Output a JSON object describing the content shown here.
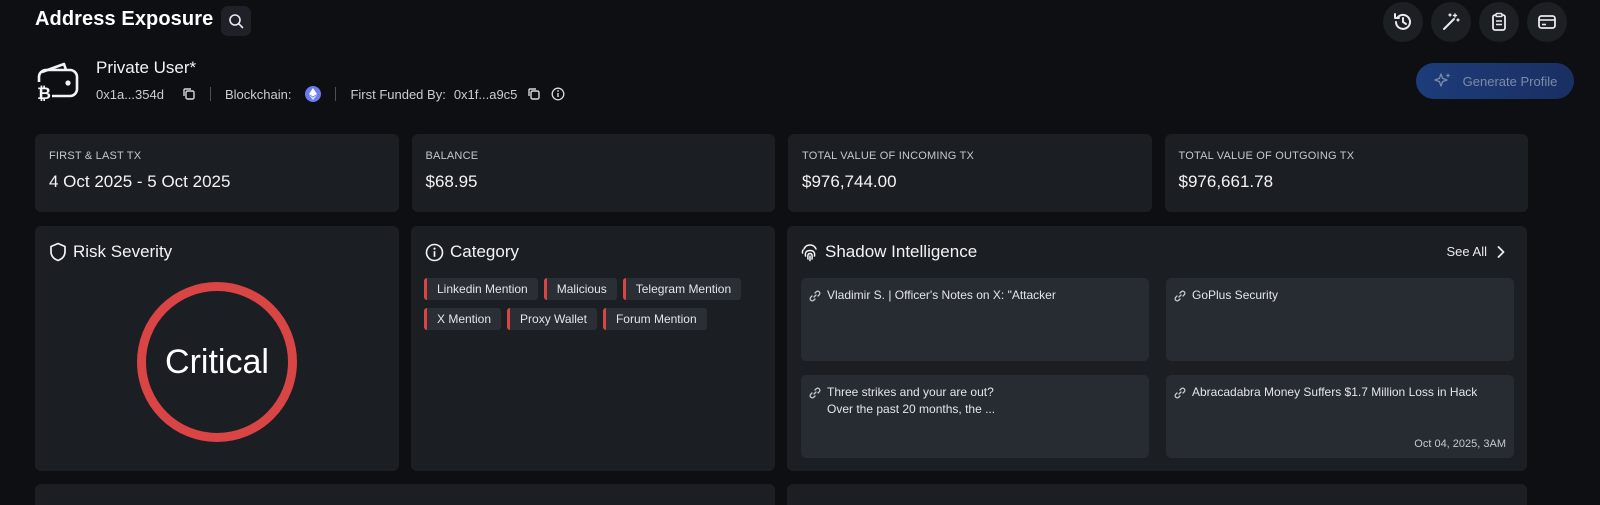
{
  "header": {
    "title": "Address Exposure",
    "icons": [
      "search-icon",
      "history-icon",
      "magic-wand-icon",
      "clipboard-icon",
      "card-icon"
    ]
  },
  "profile": {
    "name": "Private User*",
    "address": "0x1a...354d",
    "blockchain_label": "Blockchain:",
    "first_funded_label": "First Funded By:",
    "first_funded_address": "0x1f...a9c5",
    "generate_button": "Generate Profile"
  },
  "stats": [
    {
      "label": "FIRST & LAST TX",
      "value": "4 Oct 2025 - 5 Oct 2025"
    },
    {
      "label": "BALANCE",
      "value": "$68.95"
    },
    {
      "label": "TOTAL VALUE OF INCOMING TX",
      "value": "$976,744.00"
    },
    {
      "label": "TOTAL VALUE OF OUTGOING TX",
      "value": "$976,661.78"
    }
  ],
  "risk": {
    "title": "Risk Severity",
    "level": "Critical",
    "color": "#d94444"
  },
  "category": {
    "title": "Category",
    "tags": [
      "Linkedin Mention",
      "Malicious",
      "Telegram Mention",
      "X Mention",
      "Proxy Wallet",
      "Forum Mention"
    ]
  },
  "shadow": {
    "title": "Shadow Intelligence",
    "see_all": "See All",
    "cards": [
      {
        "line1": "Vladimir S. | Officer's Notes on X: \"Attacker",
        "line2": "",
        "date": ""
      },
      {
        "line1": "GoPlus Security",
        "line2": "",
        "date": ""
      },
      {
        "line1": "Three strikes and your are out?",
        "line2": "Over the past 20 months, the ...",
        "date": ""
      },
      {
        "line1": "Abracadabra Money Suffers $1.7 Million Loss in Hack",
        "line2": "",
        "date": "Oct 04, 2025, 3AM"
      }
    ]
  },
  "colors": {
    "background": "#0d0f12",
    "card": "#1b1e23",
    "accent_red": "#d94444",
    "button_blue": "#1d3c7a"
  }
}
